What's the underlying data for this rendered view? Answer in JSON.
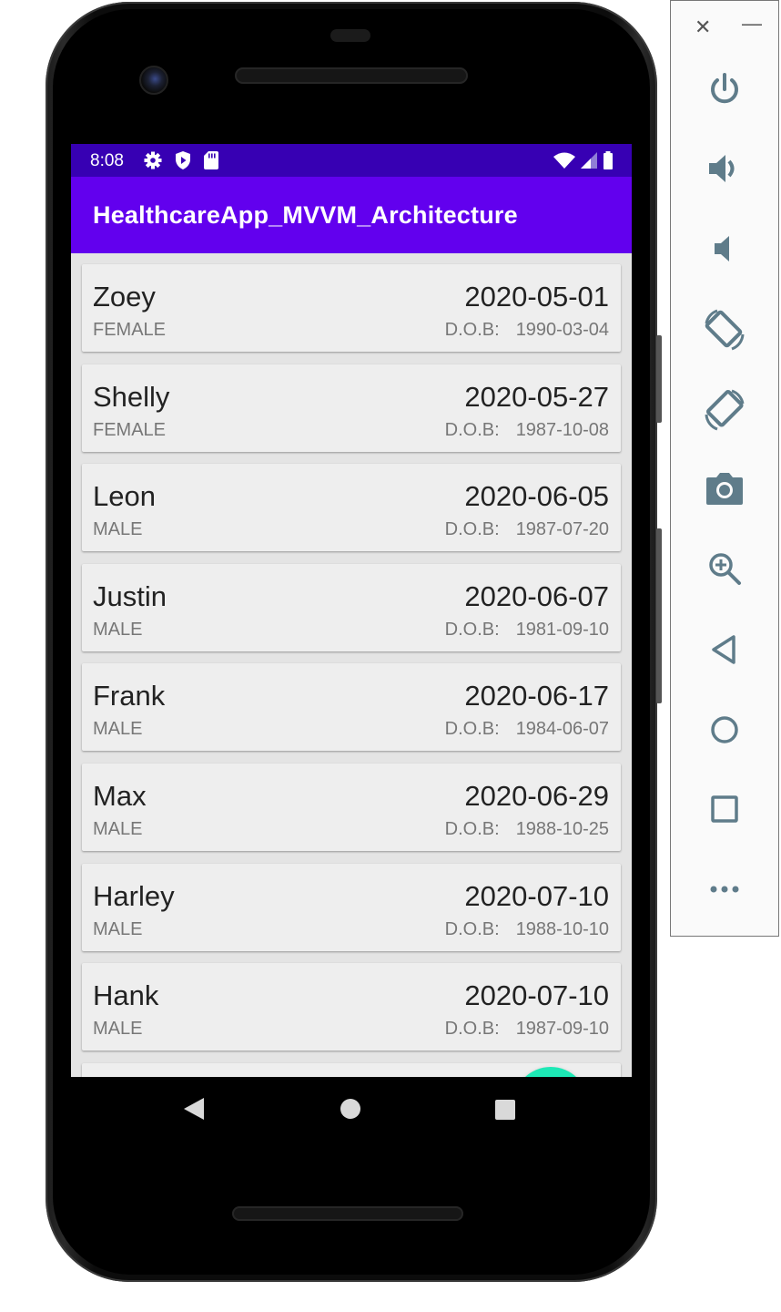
{
  "status_bar": {
    "time": "8:08"
  },
  "app_bar": {
    "title": "HealthcareApp_MVVM_Architecture"
  },
  "dob_label": "D.O.B:",
  "patients": [
    {
      "name": "Zoey",
      "gender": "FEMALE",
      "date": "2020-05-01",
      "dob": "1990-03-04"
    },
    {
      "name": "Shelly",
      "gender": "FEMALE",
      "date": "2020-05-27",
      "dob": "1987-10-08"
    },
    {
      "name": "Leon",
      "gender": "MALE",
      "date": "2020-06-05",
      "dob": "1987-07-20"
    },
    {
      "name": "Justin",
      "gender": "MALE",
      "date": "2020-06-07",
      "dob": "1981-09-10"
    },
    {
      "name": "Frank",
      "gender": "MALE",
      "date": "2020-06-17",
      "dob": "1984-06-07"
    },
    {
      "name": "Max",
      "gender": "MALE",
      "date": "2020-06-29",
      "dob": "1988-10-25"
    },
    {
      "name": "Harley",
      "gender": "MALE",
      "date": "2020-07-10",
      "dob": "1988-10-10"
    },
    {
      "name": "Hank",
      "gender": "MALE",
      "date": "2020-07-10",
      "dob": "1987-09-10"
    }
  ],
  "fab": {
    "icon": "add-document-icon",
    "color": "#1de9b6"
  },
  "colors": {
    "status_bar": "#3700b3",
    "app_bar": "#6200ee",
    "accent": "#1de9b6"
  },
  "emulator_toolbar": [
    "power-icon",
    "volume-up-icon",
    "volume-down-icon",
    "rotate-left-icon",
    "rotate-right-icon",
    "camera-icon",
    "zoom-icon",
    "back-icon",
    "home-icon",
    "overview-icon",
    "more-icon"
  ]
}
